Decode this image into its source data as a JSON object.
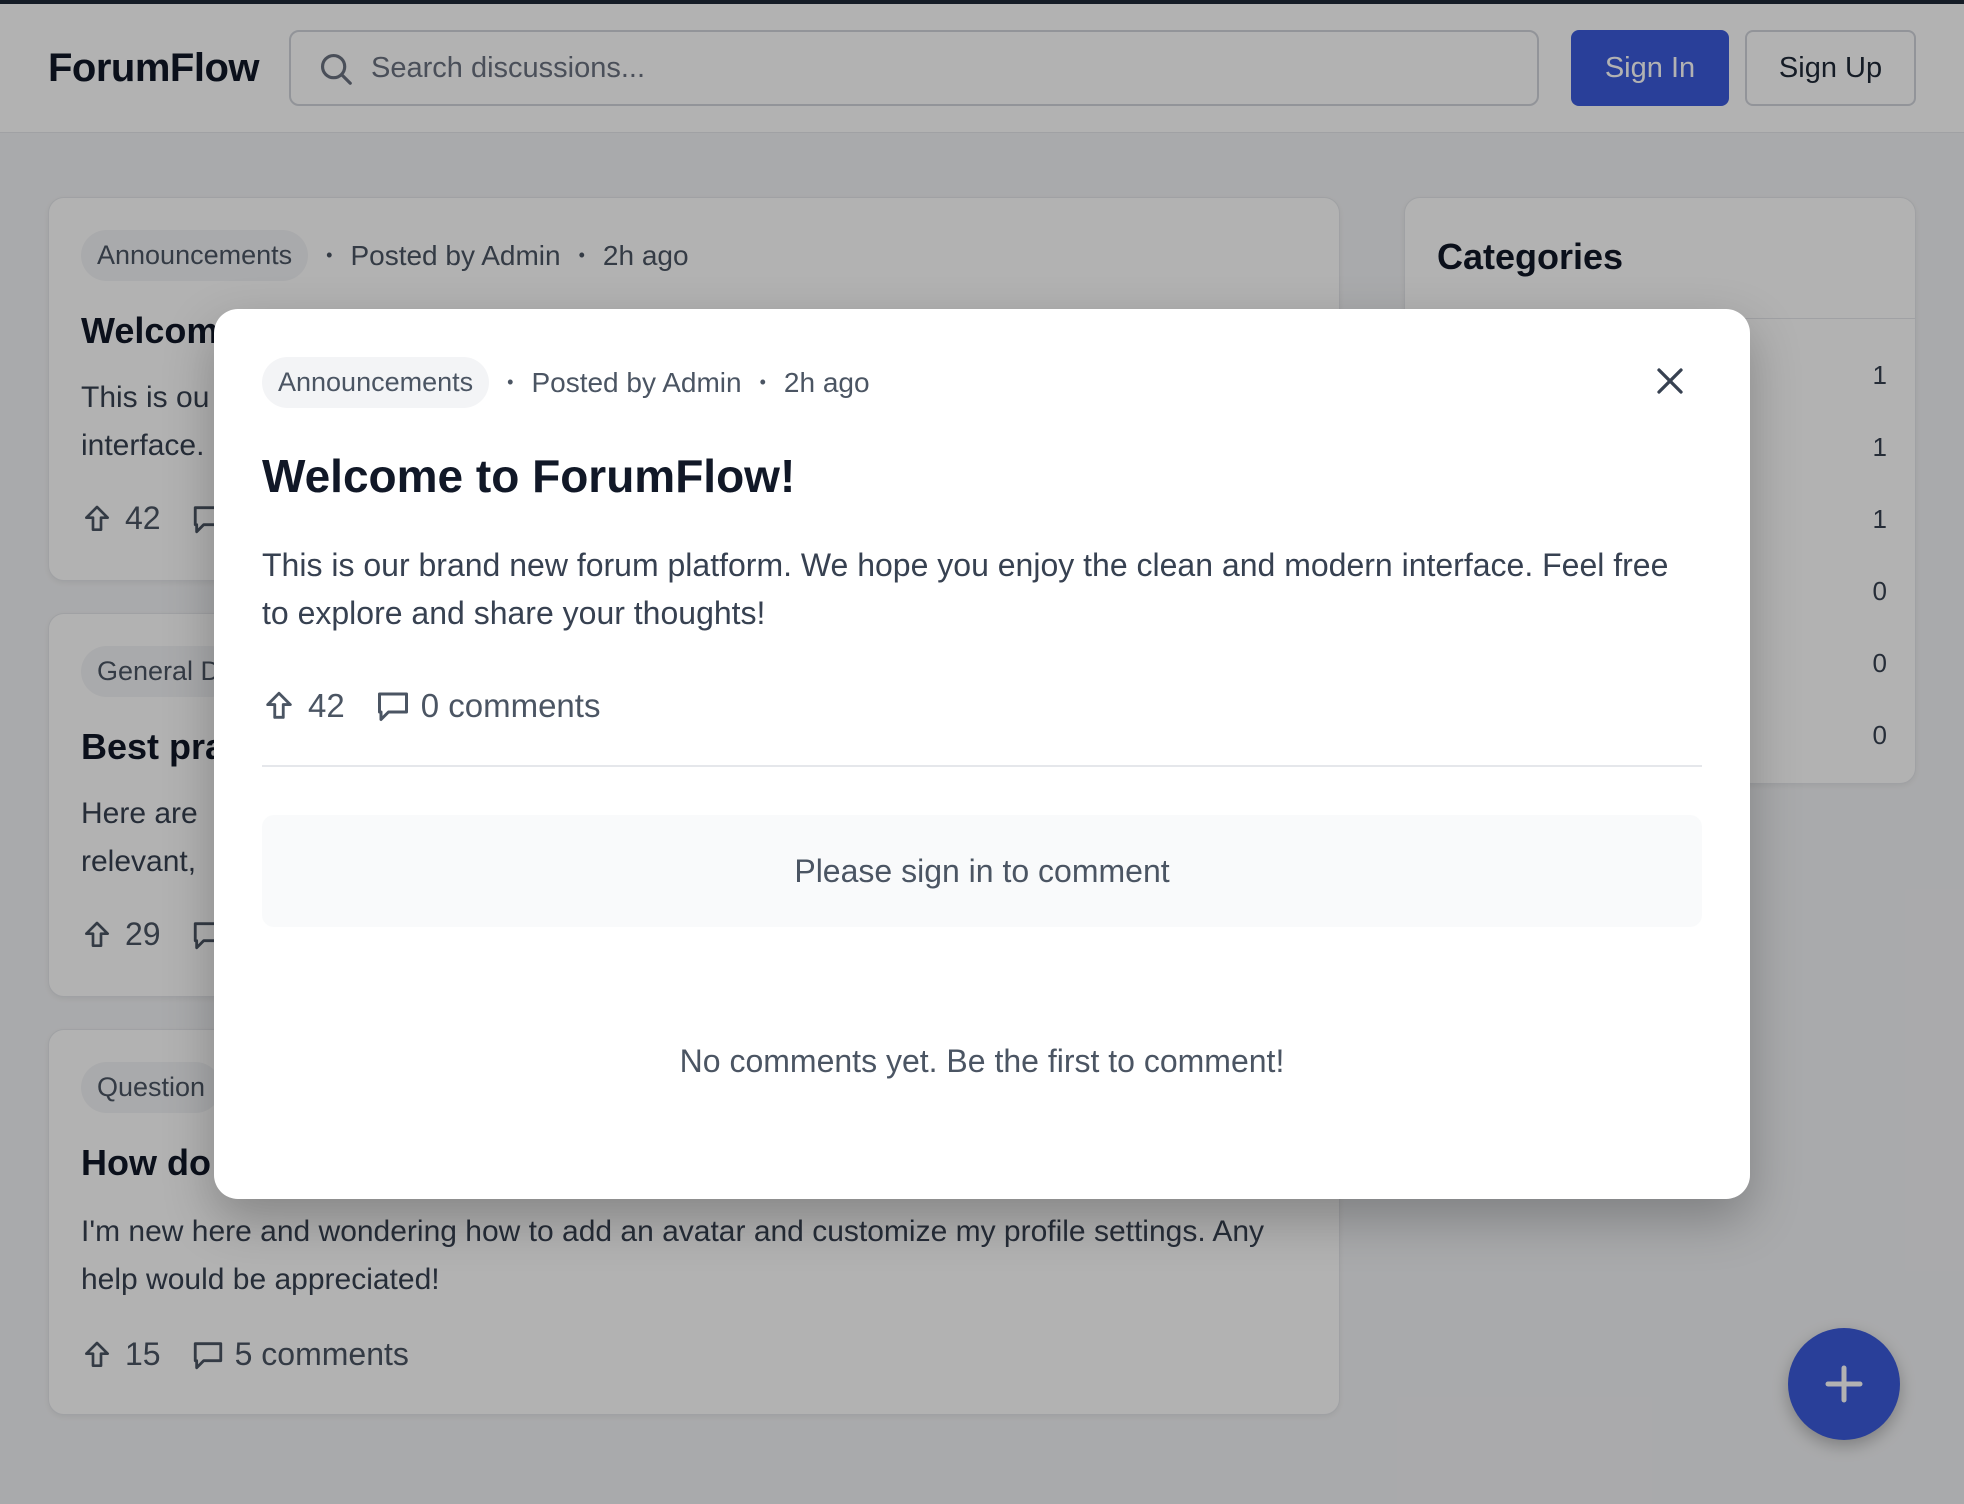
{
  "header": {
    "logo": "ForumFlow",
    "search_placeholder": "Search discussions...",
    "signin_label": "Sign In",
    "signup_label": "Sign Up"
  },
  "posts": [
    {
      "category": "Announcements",
      "author": "Posted by Admin",
      "time": "2h ago",
      "title_visible": "Welcom",
      "body_visible_lines": [
        "This is ou",
        "interface."
      ],
      "upvotes": "42"
    },
    {
      "category_visible": "General D",
      "title_visible": "Best pra",
      "body_visible_lines": [
        "Here are",
        "relevant,"
      ],
      "upvotes": "29"
    },
    {
      "category_visible": "Question",
      "title_visible": "How do",
      "body": "I'm new here and wondering how to add an avatar and customize my profile settings. Any help would be appreciated!",
      "upvotes": "15",
      "comments": "5 comments"
    }
  ],
  "sidebar": {
    "title": "Categories",
    "counts": [
      "1",
      "1",
      "1",
      "0",
      "0",
      "0"
    ]
  },
  "modal": {
    "category": "Announcements",
    "author": "Posted by Admin",
    "time": "2h ago",
    "title": "Welcome to ForumFlow!",
    "body": "This is our brand new forum platform. We hope you enjoy the clean and modern interface. Feel free to explore and share your thoughts!",
    "upvotes": "42",
    "comments": "0 comments",
    "signin_prompt": "Please sign in to comment",
    "empty_comments": "No comments yet. Be the first to comment!"
  },
  "icons": {
    "search": "search-icon",
    "upvote": "arrow-up-icon",
    "comment": "comment-bubble-icon",
    "close": "close-icon",
    "plus": "plus-icon"
  },
  "colors": {
    "accent": "#3b5bdb",
    "overlay": "rgba(0,0,0,0.3)"
  }
}
